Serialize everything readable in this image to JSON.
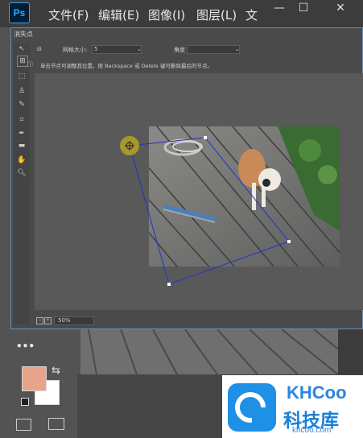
{
  "menubar": {
    "logo": "Ps",
    "items": [
      "文件(F)",
      "编辑(E)",
      "图像(I)",
      "图层(L)",
      "文"
    ]
  },
  "dialog": {
    "title": "消失点",
    "grid_label": "网格大小:",
    "grid_value": "5",
    "angle_label": "角度",
    "info_text": "单击节点可调整其位置。按 Backspace 或 Delete 键可删除最后的节点。",
    "zoom_value": "50%"
  },
  "toolbox": {
    "more": "•••"
  },
  "watermark": {
    "brand": "KHCoo",
    "name": "科技库",
    "url": "khcoo.com"
  },
  "colors": {
    "foreground": "#e8a48a",
    "background": "#ffffff",
    "selection": "#2233cc"
  }
}
